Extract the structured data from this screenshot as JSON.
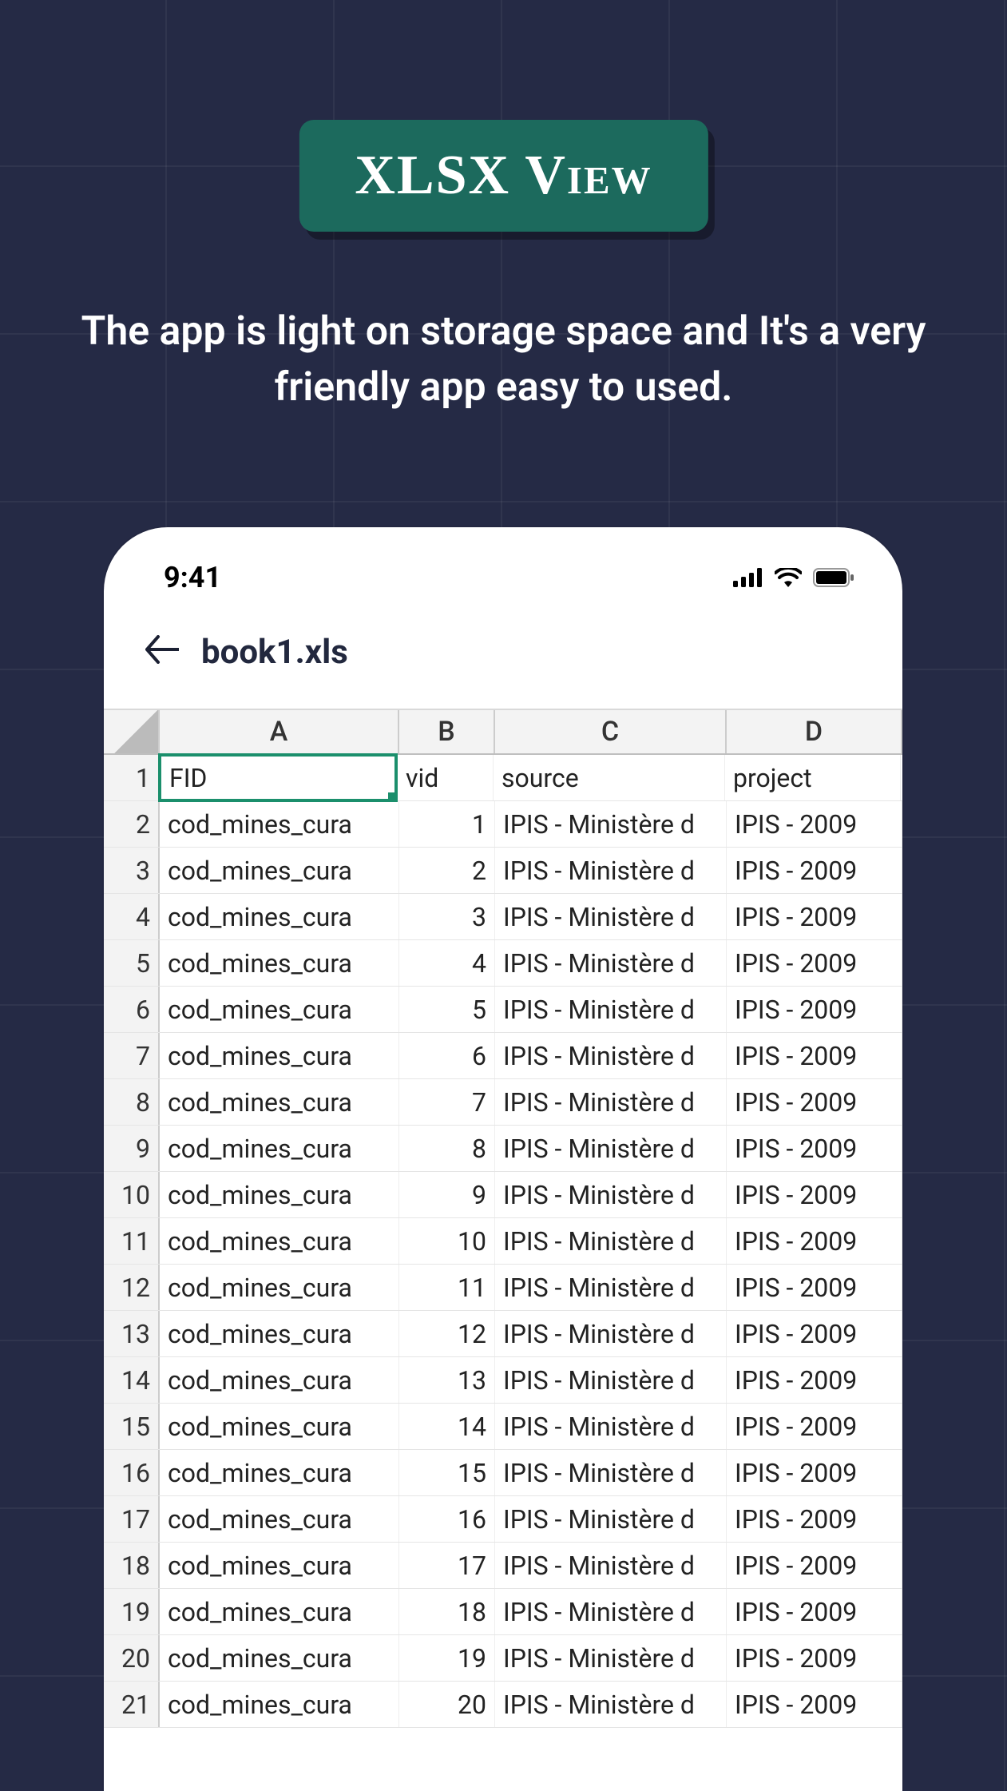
{
  "badge": {
    "text": "XLSX View"
  },
  "tagline": "The app is light on storage space and It's a very friendly app easy to used.",
  "status": {
    "time": "9:41"
  },
  "appbar": {
    "filename": "book1.xls"
  },
  "sheet": {
    "columns": [
      "A",
      "B",
      "C",
      "D"
    ],
    "headerRow": {
      "A": "FID",
      "B": "vid",
      "C": "source",
      "D": "project"
    },
    "rows": [
      {
        "n": 1,
        "A": "FID",
        "B": "vid",
        "C": "source",
        "D": "project"
      },
      {
        "n": 2,
        "A": "cod_mines_cura",
        "B": "1",
        "C": "IPIS - Ministère d",
        "D": "IPIS - 2009"
      },
      {
        "n": 3,
        "A": "cod_mines_cura",
        "B": "2",
        "C": "IPIS - Ministère d",
        "D": "IPIS - 2009"
      },
      {
        "n": 4,
        "A": "cod_mines_cura",
        "B": "3",
        "C": "IPIS - Ministère d",
        "D": "IPIS - 2009"
      },
      {
        "n": 5,
        "A": "cod_mines_cura",
        "B": "4",
        "C": "IPIS - Ministère d",
        "D": "IPIS - 2009"
      },
      {
        "n": 6,
        "A": "cod_mines_cura",
        "B": "5",
        "C": "IPIS - Ministère d",
        "D": "IPIS - 2009"
      },
      {
        "n": 7,
        "A": "cod_mines_cura",
        "B": "6",
        "C": "IPIS - Ministère d",
        "D": "IPIS - 2009"
      },
      {
        "n": 8,
        "A": "cod_mines_cura",
        "B": "7",
        "C": "IPIS - Ministère d",
        "D": "IPIS - 2009"
      },
      {
        "n": 9,
        "A": "cod_mines_cura",
        "B": "8",
        "C": "IPIS - Ministère d",
        "D": "IPIS - 2009"
      },
      {
        "n": 10,
        "A": "cod_mines_cura",
        "B": "9",
        "C": "IPIS - Ministère d",
        "D": "IPIS - 2009"
      },
      {
        "n": 11,
        "A": "cod_mines_cura",
        "B": "10",
        "C": "IPIS - Ministère d",
        "D": "IPIS - 2009"
      },
      {
        "n": 12,
        "A": "cod_mines_cura",
        "B": "11",
        "C": "IPIS - Ministère d",
        "D": "IPIS - 2009"
      },
      {
        "n": 13,
        "A": "cod_mines_cura",
        "B": "12",
        "C": "IPIS - Ministère d",
        "D": "IPIS - 2009"
      },
      {
        "n": 14,
        "A": "cod_mines_cura",
        "B": "13",
        "C": "IPIS - Ministère d",
        "D": "IPIS - 2009"
      },
      {
        "n": 15,
        "A": "cod_mines_cura",
        "B": "14",
        "C": "IPIS - Ministère d",
        "D": "IPIS - 2009"
      },
      {
        "n": 16,
        "A": "cod_mines_cura",
        "B": "15",
        "C": "IPIS - Ministère d",
        "D": "IPIS - 2009"
      },
      {
        "n": 17,
        "A": "cod_mines_cura",
        "B": "16",
        "C": "IPIS - Ministère d",
        "D": "IPIS - 2009"
      },
      {
        "n": 18,
        "A": "cod_mines_cura",
        "B": "17",
        "C": "IPIS - Ministère d",
        "D": "IPIS - 2009"
      },
      {
        "n": 19,
        "A": "cod_mines_cura",
        "B": "18",
        "C": "IPIS - Ministère d",
        "D": "IPIS - 2009"
      },
      {
        "n": 20,
        "A": "cod_mines_cura",
        "B": "19",
        "C": "IPIS - Ministère d",
        "D": "IPIS - 2009"
      },
      {
        "n": 21,
        "A": "cod_mines_cura",
        "B": "20",
        "C": "IPIS - Ministère d",
        "D": "IPIS - 2009"
      }
    ]
  }
}
